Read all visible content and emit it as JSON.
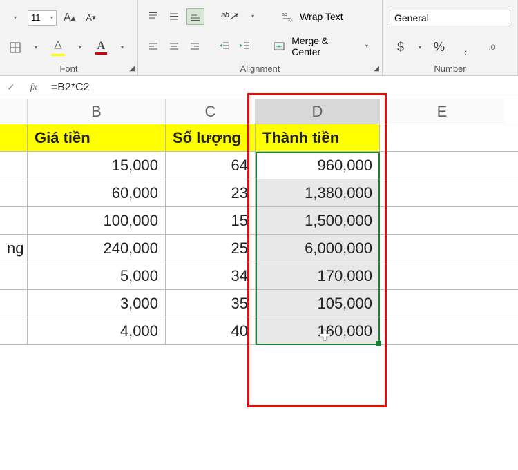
{
  "ribbon": {
    "font_size": "11",
    "group_font": "Font",
    "group_alignment": "Alignment",
    "group_number": "Number",
    "wrap_text": "Wrap Text",
    "merge_center": "Merge & Center",
    "number_format": "General",
    "currency": "$",
    "percent": "%",
    "comma": ","
  },
  "formula_bar": {
    "fx": "fx",
    "formula": "=B2*C2"
  },
  "columns": {
    "B": "B",
    "C": "C",
    "D": "D",
    "E": "E"
  },
  "headers": {
    "A_frag": "",
    "B": "Giá tiền",
    "C": "Số lượng",
    "D": "Thành tiền"
  },
  "chart_data": {
    "type": "table",
    "columns": [
      "Giá tiền",
      "Số lượng",
      "Thành tiền"
    ],
    "a_fragment": [
      "",
      "",
      "",
      "",
      "ng",
      "",
      "",
      ""
    ],
    "rows": [
      {
        "price": "15,000",
        "qty": "64",
        "total": "960,000"
      },
      {
        "price": "60,000",
        "qty": "23",
        "total": "1,380,000"
      },
      {
        "price": "100,000",
        "qty": "15",
        "total": "1,500,000"
      },
      {
        "price": "240,000",
        "qty": "25",
        "total": "6,000,000"
      },
      {
        "price": "5,000",
        "qty": "34",
        "total": "170,000"
      },
      {
        "price": "3,000",
        "qty": "35",
        "total": "105,000"
      },
      {
        "price": "4,000",
        "qty": "40",
        "total": "160,000"
      }
    ]
  }
}
